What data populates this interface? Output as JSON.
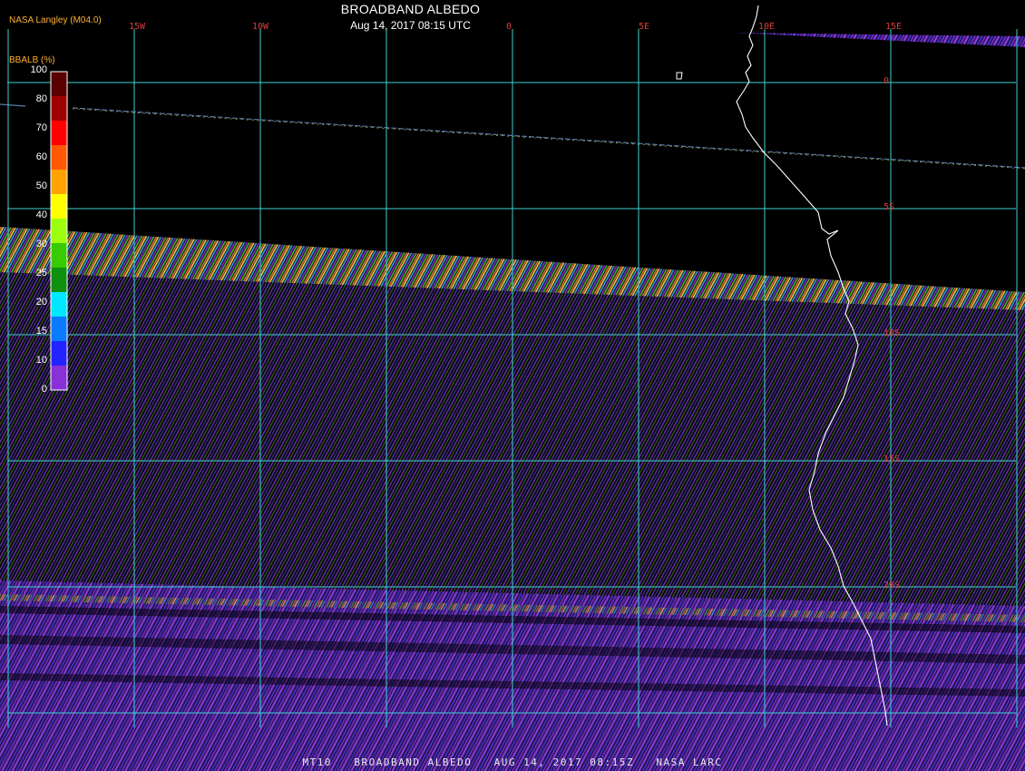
{
  "title": "BROADBAND ALBEDO",
  "subtitle": "Aug 14, 2017 08:15 UTC",
  "producer": "NASA Langley (M04.0)",
  "colorbar": {
    "label": "BBALB (%)",
    "ticks": [
      "0",
      "10",
      "15",
      "20",
      "25",
      "30",
      "40",
      "50",
      "60",
      "70",
      "80",
      "100"
    ],
    "colors": [
      "#8a30d8",
      "#2323ff",
      "#0a7bff",
      "#00e8ff",
      "#109010",
      "#38cc00",
      "#9cff10",
      "#ffff00",
      "#ffa300",
      "#ff5800",
      "#ff0000",
      "#a00000",
      "#5a0000"
    ]
  },
  "grid": {
    "longitudes": [
      {
        "label": "15W",
        "value": -15
      },
      {
        "label": "10W",
        "value": -10
      },
      {
        "label": "0",
        "value": 0
      },
      {
        "label": "5E",
        "value": 5
      },
      {
        "label": "10E",
        "value": 10
      },
      {
        "label": "15E",
        "value": 15
      }
    ],
    "unlabeled_longitudes": [
      -20,
      -5,
      20
    ],
    "latitudes": [
      {
        "label": "0",
        "value": 0
      },
      {
        "label": "5S",
        "value": -5
      },
      {
        "label": "10S",
        "value": -10
      },
      {
        "label": "15S",
        "value": -15
      },
      {
        "label": "20S",
        "value": -20
      }
    ],
    "unlabeled_latitudes": [
      -25
    ],
    "line_color": "#40d0d0",
    "label_color": "#e03c3c"
  },
  "footer": "MT10   BROADBAND ALBEDO   AUG 14, 2017 08:15Z   NASA LARC"
}
